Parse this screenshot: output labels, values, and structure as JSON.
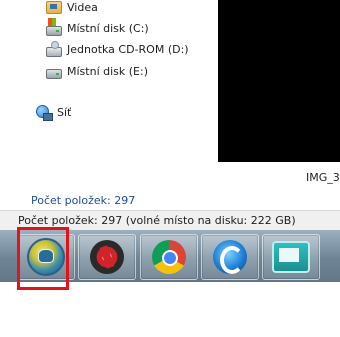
{
  "nav_pane": {
    "items": [
      {
        "label": "Videa",
        "icon": "videos-folder-icon"
      },
      {
        "label": "Místní disk (C:)",
        "icon": "local-disk-c-icon"
      },
      {
        "label": "Jednotka CD-ROM (D:)",
        "icon": "cd-rom-drive-icon"
      },
      {
        "label": "Místní disk (E:)",
        "icon": "local-disk-e-icon"
      }
    ],
    "network": {
      "label": "Síť",
      "icon": "network-icon"
    }
  },
  "item_count": "Počet položek: 297",
  "preview": {
    "label": "IMG_3"
  },
  "status_bar": {
    "text": "Počet položek: 297 (volné místo na disku: 222 GB)"
  },
  "taskbar": {
    "buttons": [
      {
        "icon": "blue-yellow-app-icon",
        "highlighted": true
      },
      {
        "icon": "red-black-app-icon",
        "highlighted": true
      },
      {
        "icon": "chrome-icon",
        "highlighted": true
      },
      {
        "icon": "blue-c-app-icon",
        "highlighted": true
      },
      {
        "icon": "teal-window-app-icon",
        "highlighted": true
      }
    ]
  },
  "colors": {
    "highlight_box": "#e3121b",
    "link_text": "#1f4e9c",
    "taskbar": "#6f8596"
  }
}
